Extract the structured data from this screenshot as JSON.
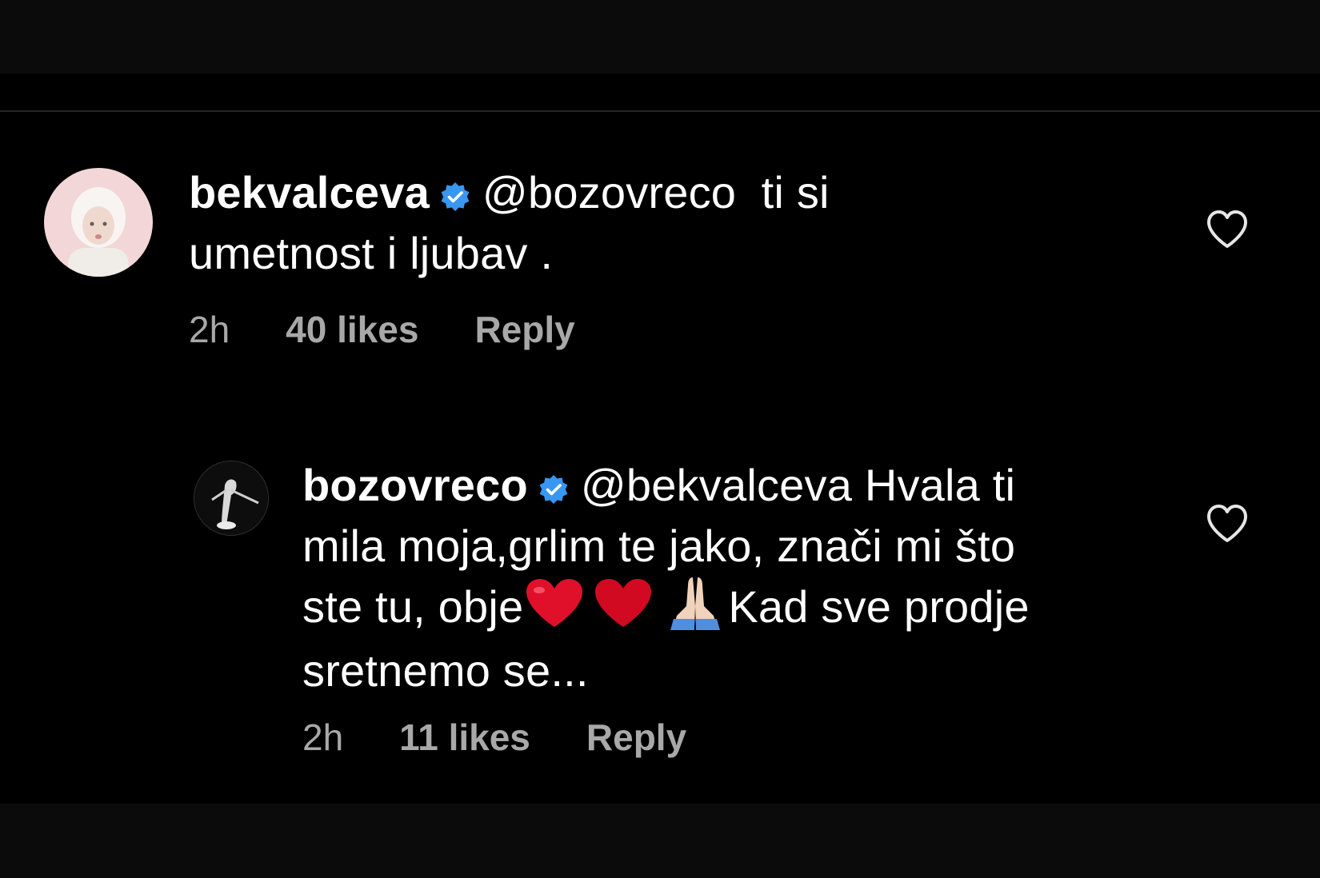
{
  "comments": [
    {
      "username": "bekvalceva",
      "mention": "@bozovreco",
      "text_line1": "ti si",
      "text_line2": "umetnost i ljubav .",
      "time": "2h",
      "likes": "40 likes",
      "reply": "Reply"
    },
    {
      "username": "bozovreco",
      "mention": "@bekvalceva",
      "text_line1": "Hvala ti",
      "text_line2": "mila moja,grlim te jako, znači mi što",
      "text_line3a": "ste tu, obje",
      "text_line3b": "Kad sve prodje",
      "text_line4": "sretnemo se...",
      "time": "2h",
      "likes": "11 likes",
      "reply": "Reply"
    }
  ],
  "icons": {
    "verified": "verified-badge-icon",
    "like": "heart-outline-icon",
    "emoji_heart": "red-heart-emoji",
    "emoji_pray": "folded-hands-emoji"
  },
  "colors": {
    "background": "#000000",
    "text": "#ffffff",
    "meta": "#a8a8a8",
    "verified": "#3897f0",
    "heart_emoji": "#e0102a"
  }
}
